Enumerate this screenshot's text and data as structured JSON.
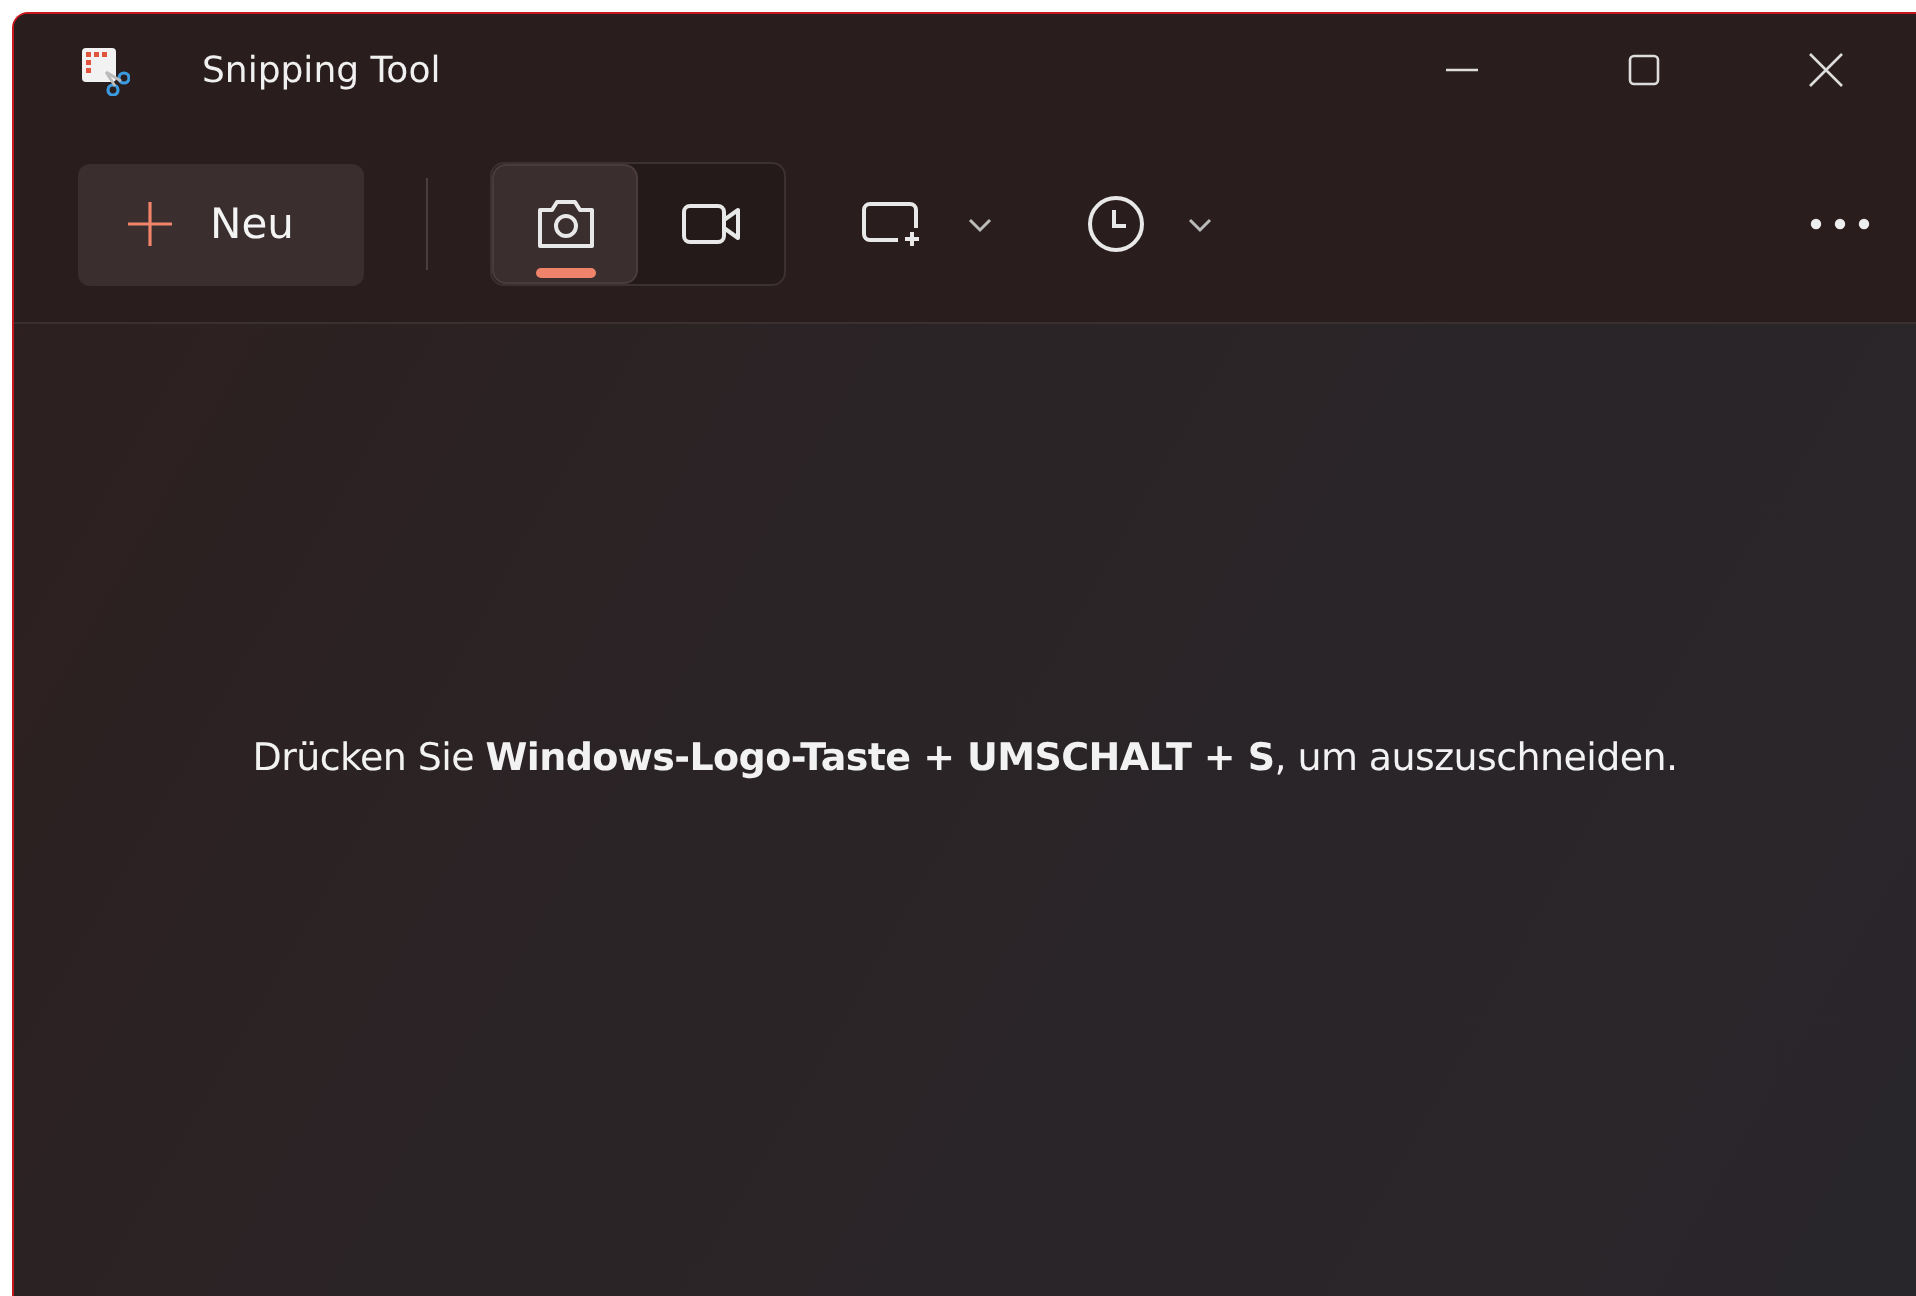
{
  "window": {
    "title": "Snipping Tool"
  },
  "toolbar": {
    "new_button": {
      "label": "Neu"
    },
    "modes": [
      {
        "kind": "photo",
        "selected": true
      },
      {
        "kind": "video",
        "selected": false
      }
    ]
  },
  "hint": "Drücken Sie **Windows-Logo-Taste + UMSCHALT + S**, um auszuschneiden."
}
